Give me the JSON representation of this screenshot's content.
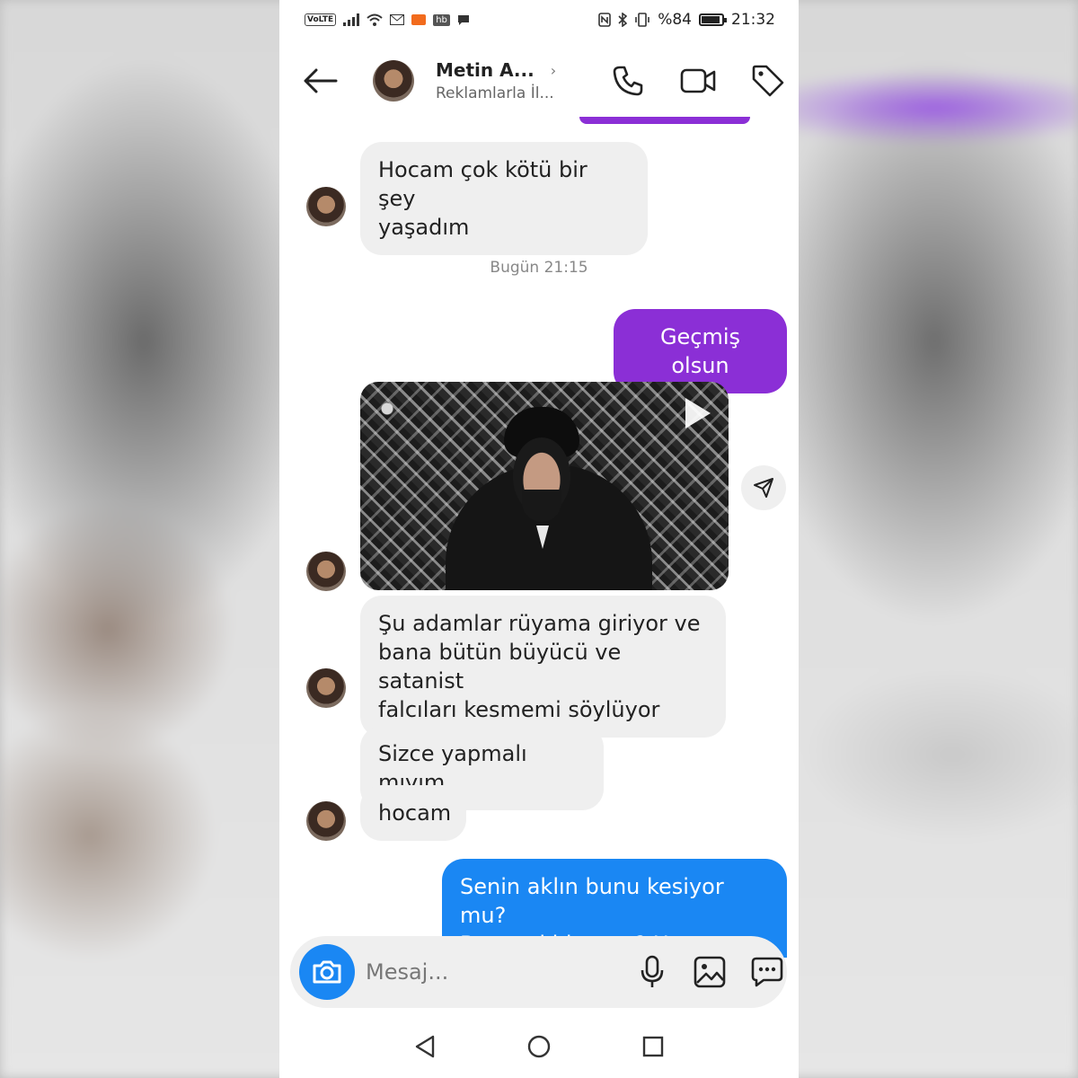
{
  "status_bar": {
    "volte": "VoLTE",
    "hb": "hb",
    "battery": "%84",
    "time": "21:32"
  },
  "header": {
    "contact_name": "Metin A...",
    "contact_subtitle": "Reklamlarla İl..."
  },
  "messages": {
    "m1": {
      "line1": "Hocam çok kötü bir şey",
      "line2": "yaşadım"
    },
    "timestamp": "Bugün 21:15",
    "m2": "Geçmiş olsun",
    "m3": {
      "line1": "Şu adamlar rüyama giriyor ve",
      "line2": "bana bütün büyücü ve satanist",
      "line3": "falcıları kesmemi söylüyor"
    },
    "m4": "Sizce yapmalı mıyım",
    "m5": "hocam",
    "m6": {
      "line1": "Senin aklın bunu kesiyor mu?",
      "line2": "Bu nasıl bir soru? Hemen"
    }
  },
  "input": {
    "placeholder": "Mesaj..."
  },
  "colors": {
    "accent_purple": "#8b2fd6",
    "sent_blue": "#1a87f3",
    "received_bg": "#efefef"
  },
  "icons": {
    "back": "arrow-left-icon",
    "call": "phone-icon",
    "video": "video-camera-icon",
    "tag": "tag-icon",
    "share": "send-icon",
    "camera": "camera-icon",
    "mic": "microphone-icon",
    "gallery": "image-icon",
    "chat": "chat-bubble-icon",
    "sticker": "sticker-icon"
  }
}
